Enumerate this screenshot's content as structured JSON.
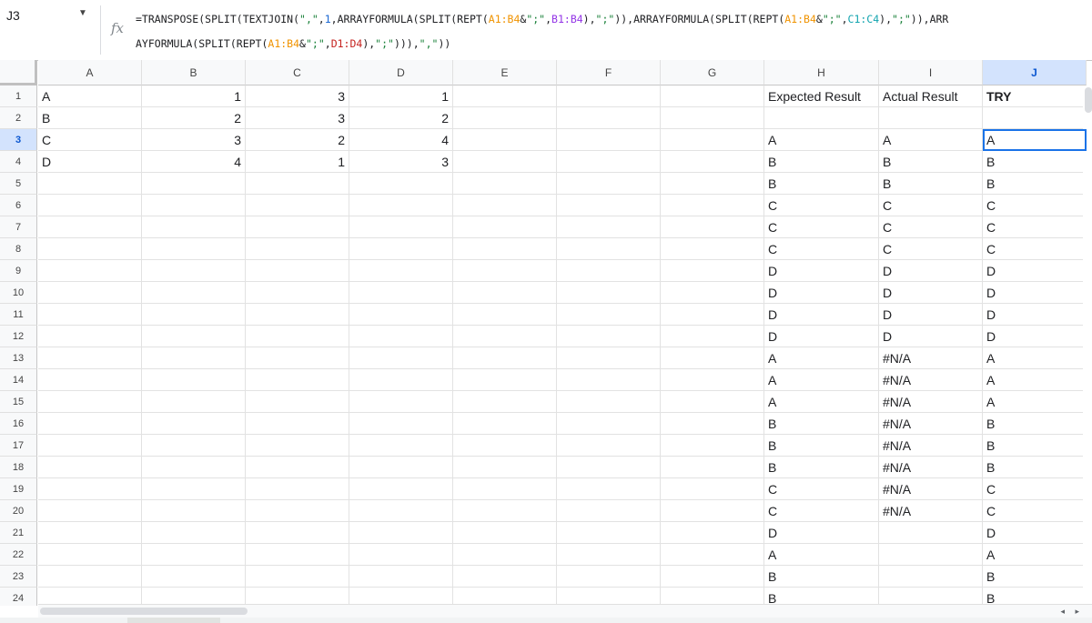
{
  "namebox": {
    "ref": "J3",
    "dropdown_icon": "▼"
  },
  "formula_bar": {
    "fx_icon": "fx",
    "lines": [
      [
        {
          "t": "=TRANSPOSE(SPLIT(TEXTJOIN(",
          "c": "#202124"
        },
        {
          "t": "\",\"",
          "c": "#188038"
        },
        {
          "t": ",",
          "c": "#202124"
        },
        {
          "t": "1",
          "c": "#1967d2"
        },
        {
          "t": ",ARRAYFORMULA(SPLIT(REPT(",
          "c": "#202124"
        },
        {
          "t": "A1:B4",
          "c": "#f09300"
        },
        {
          "t": "&",
          "c": "#202124"
        },
        {
          "t": "\";\"",
          "c": "#188038"
        },
        {
          "t": ",",
          "c": "#202124"
        },
        {
          "t": "B1:B4",
          "c": "#9334e6"
        },
        {
          "t": "),",
          "c": "#202124"
        },
        {
          "t": "\";\"",
          "c": "#188038"
        },
        {
          "t": ")),ARRAYFORMULA(SPLIT(REPT(",
          "c": "#202124"
        },
        {
          "t": "A1:B4",
          "c": "#f09300"
        },
        {
          "t": "&",
          "c": "#202124"
        },
        {
          "t": "\";\"",
          "c": "#188038"
        },
        {
          "t": ",",
          "c": "#202124"
        },
        {
          "t": "C1:C4",
          "c": "#12a4af"
        },
        {
          "t": "),",
          "c": "#202124"
        },
        {
          "t": "\";\"",
          "c": "#188038"
        },
        {
          "t": ")),ARR",
          "c": "#202124"
        }
      ],
      [
        {
          "t": "AYFORMULA(SPLIT(REPT(",
          "c": "#202124"
        },
        {
          "t": "A1:B4",
          "c": "#f09300"
        },
        {
          "t": "&",
          "c": "#202124"
        },
        {
          "t": "\";\"",
          "c": "#188038"
        },
        {
          "t": ",",
          "c": "#202124"
        },
        {
          "t": "D1:D4",
          "c": "#c5221f"
        },
        {
          "t": "),",
          "c": "#202124"
        },
        {
          "t": "\";\"",
          "c": "#188038"
        },
        {
          "t": "))),",
          "c": "#202124"
        },
        {
          "t": "\",\"",
          "c": "#188038"
        },
        {
          "t": "))",
          "c": "#202124"
        }
      ]
    ]
  },
  "columns": [
    "A",
    "B",
    "C",
    "D",
    "E",
    "F",
    "G",
    "H",
    "I",
    "J"
  ],
  "selected_column": "J",
  "selected_row": 3,
  "active_cell": "J3",
  "rows": [
    {
      "A": "A",
      "B": "1",
      "C": "3",
      "D": "1",
      "H": "Expected Result",
      "I": "Actual Result",
      "J": "TRY"
    },
    {},
    {
      "A": "C",
      "B": "3",
      "C": "2",
      "D": "4",
      "H": "A",
      "I": "A",
      "J": "A"
    },
    {
      "A": "D",
      "B": "4",
      "C": "1",
      "D": "3",
      "H": "B",
      "I": "B",
      "J": "B"
    },
    {
      "H": "B",
      "I": "B",
      "J": "B"
    },
    {
      "H": "C",
      "I": "C",
      "J": "C"
    },
    {
      "H": "C",
      "I": "C",
      "J": "C"
    },
    {
      "H": "C",
      "I": "C",
      "J": "C"
    },
    {
      "H": "D",
      "I": "D",
      "J": "D"
    },
    {
      "H": "D",
      "I": "D",
      "J": "D"
    },
    {
      "H": "D",
      "I": "D",
      "J": "D"
    },
    {
      "H": "D",
      "I": "D",
      "J": "D"
    },
    {
      "H": "A",
      "I": "#N/A",
      "J": "A"
    },
    {
      "H": "A",
      "I": "#N/A",
      "J": "A"
    },
    {
      "H": "A",
      "I": "#N/A",
      "J": "A"
    },
    {
      "H": "B",
      "I": "#N/A",
      "J": "B"
    },
    {
      "H": "B",
      "I": "#N/A",
      "J": "B"
    },
    {
      "H": "B",
      "I": "#N/A",
      "J": "B"
    },
    {
      "H": "C",
      "I": "#N/A",
      "J": "C"
    },
    {
      "H": "C",
      "I": "#N/A",
      "J": "C"
    },
    {
      "H": "D",
      "J": "D"
    },
    {
      "H": "A",
      "J": "A"
    },
    {
      "H": "B",
      "J": "B"
    },
    {
      "H": "B",
      "J": "B"
    }
  ],
  "row2_overrides": {
    "A": "B",
    "B": "2",
    "C": "3",
    "D": "2"
  },
  "numeric_columns": [
    "B",
    "C",
    "D"
  ],
  "bold_cells": [
    "J1"
  ],
  "scroll": {
    "left_arrow": "◂",
    "right_arrow": "▸"
  }
}
